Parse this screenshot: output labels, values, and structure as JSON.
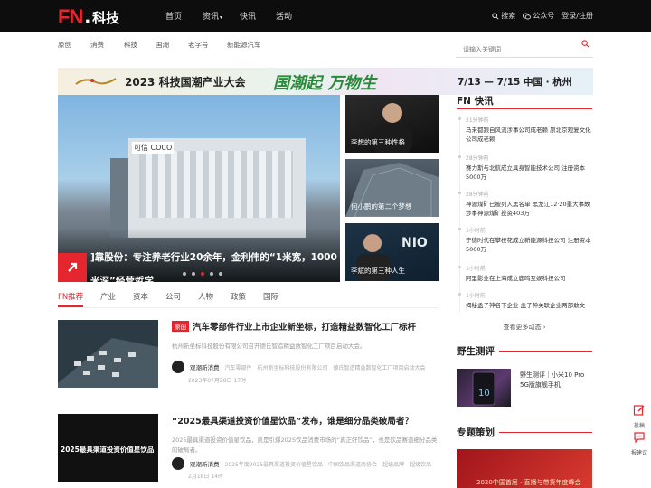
{
  "header": {
    "logo_fn": "FN",
    "logo_dot": ".",
    "logo_text": "科技",
    "nav": [
      "首页",
      "资讯",
      "快讯",
      "活动"
    ],
    "search_label": "搜索",
    "wechat_label": "公众号",
    "login_label": "登录/注册"
  },
  "categories": [
    "原创",
    "消费",
    "科技",
    "国潮",
    "老字号",
    "新能源汽车"
  ],
  "search": {
    "placeholder": "请输入关键词"
  },
  "banner": {
    "title": "2023 科技国潮产业大会",
    "slogan": "国潮起 万物生",
    "dates": "7/13 — 7/15 中国 · 杭州"
  },
  "hero": {
    "sign_text": "可信 COCO",
    "caption_line1": "]靠股份：专注养老行业20余年，金利伟的“1米宽，1000",
    "caption_line2": "米深”经营哲学",
    "active_dot": 2,
    "dot_count": 5
  },
  "side_stories": [
    {
      "label": "李想的第三种性格"
    },
    {
      "label": "何小鹏的第二个梦想"
    },
    {
      "label": "李斌的第三种人生"
    }
  ],
  "tabs": [
    "FN推荐",
    "产业",
    "资本",
    "公司",
    "人物",
    "政策",
    "国际"
  ],
  "articles": [
    {
      "tag": "原创",
      "title": "汽车零部件行业上市企业新坐标，打造精益数智化工厂标杆",
      "desc": "杭州新坐标科技股份有限公司召开德氏智造精益数智化工厂项目启动大会。",
      "author": "观潮新消费",
      "tags": [
        "汽车零部件",
        "杭州新坐标科技股份有限公司",
        "德氏智造精益数智化工厂项目启动大会"
      ],
      "date": "2023年07月28日 17时"
    },
    {
      "tag": "",
      "title": "“2025最具渠道投资价值星饮品”发布，谁是细分品类破局者？",
      "desc": "2025最具渠道投资价值星饮品，凯是引爆2025饮品消费市场的“真正好饮品”，也是饮品赛道细分品类的破局者。",
      "author": "观潮新消费",
      "tags": [
        "2025年度2025最具渠道投资价值星饮品",
        "中国饮品渠道商协会",
        "超级品牌",
        "超级饮品"
      ],
      "date": "2月18日 14时",
      "thumb_text": "2025最具渠道投资价值星饮品"
    }
  ],
  "flash": {
    "title": "FN 快讯",
    "items": [
      {
        "time": "21分钟前",
        "text": "马未都跟自风流涉事公司成老赖 原北京观复文化公司成老赖"
      },
      {
        "time": "28分钟前",
        "text": "赛力斯与北航成立具身智能技术公司 注册资本5000万"
      },
      {
        "time": "28分钟前",
        "text": "神源煤矿已被列入黑名单 黑龙江12·20重大事故涉事神源煤矿投资403万"
      },
      {
        "time": "1小时前",
        "text": "宁德时代在攀枝花成立新能源科技公司 注册资本5000万"
      },
      {
        "time": "1小时前",
        "text": "阿里影业在上海成立鹿鸣互娱科技公司"
      },
      {
        "time": "1小时前",
        "text": "揭秘孟子神名下企业 孟子神关联企业两部敢文"
      }
    ],
    "more": "查看更多动态"
  },
  "review": {
    "title": "野生测评",
    "product_name": "野生测评｜小米10 Pro 5G版旗舰手机"
  },
  "special": {
    "title": "专题策划",
    "promo_text": "2020中国首届 · 直播与带货年度峰会"
  },
  "float_buttons": [
    {
      "label": "投稿"
    },
    {
      "label": "报建议"
    }
  ],
  "colors": {
    "brand": "#e6262e",
    "topbar": "#0d0d0d"
  }
}
